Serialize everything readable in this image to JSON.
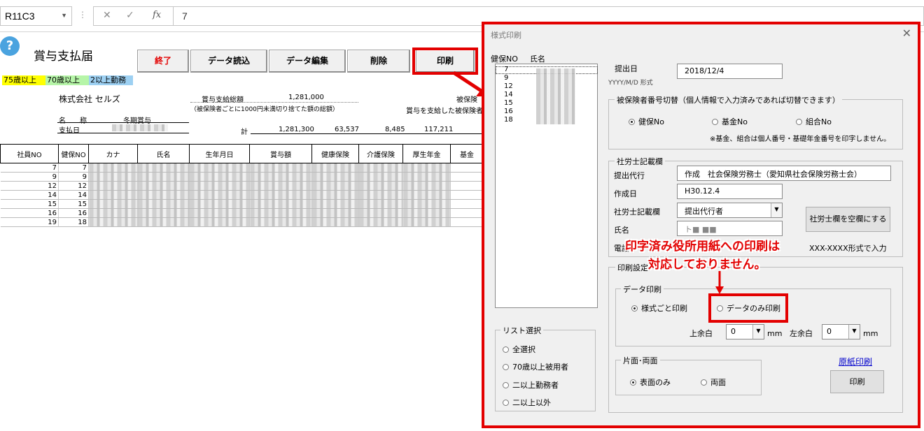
{
  "formula_bar": {
    "name_box": "R11C3",
    "formula": "7"
  },
  "sheet": {
    "title": "賞与支払届",
    "buttons": {
      "exit": "終了",
      "read": "データ読込",
      "edit": "データ編集",
      "delete": "削除",
      "print": "印刷"
    },
    "tags": {
      "t75": "75歳以上",
      "t70": "70歳以上",
      "t2": "2以上勤務"
    },
    "company": "株式会社 セルズ",
    "name_label": "名　　称",
    "name_value": "冬期賞与",
    "pay_date_label": "支払日",
    "total_label": "賞与支給総額",
    "total_value": "1,281,000",
    "total_note": "（被保険者ごとに1000円未満切り捨てた額の総額）",
    "sum_label": "計",
    "sums": [
      "1,281,300",
      "63,537",
      "8,485",
      "117,211"
    ],
    "right_label1": "被保険",
    "right_label2": "賞与を支給した被保険者",
    "columns": [
      "社員NO",
      "健保NO",
      "カナ",
      "氏名",
      "生年月日",
      "賞与額",
      "健康保険",
      "介護保険",
      "厚生年金",
      "基金"
    ],
    "rows": [
      [
        "7",
        "7"
      ],
      [
        "9",
        "9"
      ],
      [
        "12",
        "12"
      ],
      [
        "14",
        "14"
      ],
      [
        "15",
        "15"
      ],
      [
        "16",
        "16"
      ],
      [
        "19",
        "18"
      ]
    ]
  },
  "dialog": {
    "title": "様式印刷",
    "list_header": [
      "健保NO",
      "氏名"
    ],
    "list_items": [
      "7",
      "9",
      "12",
      "14",
      "15",
      "16",
      "18"
    ],
    "submit_date_label": "提出日",
    "submit_date_value": "2018/12/4",
    "date_format": "YYYY/M/D 形式",
    "insured_group": "被保険者番号切替（個人情報で入力済みであれば切替できます）",
    "insured_opts": [
      "健保No",
      "基金No",
      "組合No"
    ],
    "insured_note": "※基金、組合は個人番号・基礎年金番号を印字しません。",
    "sharoushi_group": "社労士記載欄",
    "agent_label": "提出代行",
    "agent_value": "作成　社会保険労務士（愛知県社会保険労務士会）",
    "created_label": "作成日",
    "created_value": "H30.12.4",
    "field_label": "社労士記載欄",
    "field_value": "提出代行者",
    "clear_button": "社労士欄を空欄にする",
    "name_label": "氏名",
    "name_value": "ト■ ■■",
    "phone_label": "電話",
    "phone_suffix": "XXX-XXXX形式で入力",
    "print_settings": "印刷設定",
    "data_print": "データ印刷",
    "print_opts": [
      "様式ごと印刷",
      "データのみ印刷"
    ],
    "top_margin_label": "上余白",
    "top_margin_value": "0",
    "left_margin_label": "左余白",
    "left_margin_value": "0",
    "mm": "mm",
    "duplex_group": "片面･両面",
    "duplex_opts": [
      "表面のみ",
      "両面"
    ],
    "original_print": "原紙印刷",
    "print_button": "印刷",
    "list_select": "リスト選択",
    "list_opts": [
      "全選択",
      "70歳以上被用者",
      "二以上勤務者",
      "二以上以外"
    ]
  },
  "annotation": {
    "line1": "印字済み役所用紙への印刷は",
    "line2": "対応しておりません。"
  },
  "colors": {
    "red": "#e30000",
    "tag75": "#ffff00",
    "tag70": "#b6f5a8",
    "tag2": "#9dd0f2"
  }
}
